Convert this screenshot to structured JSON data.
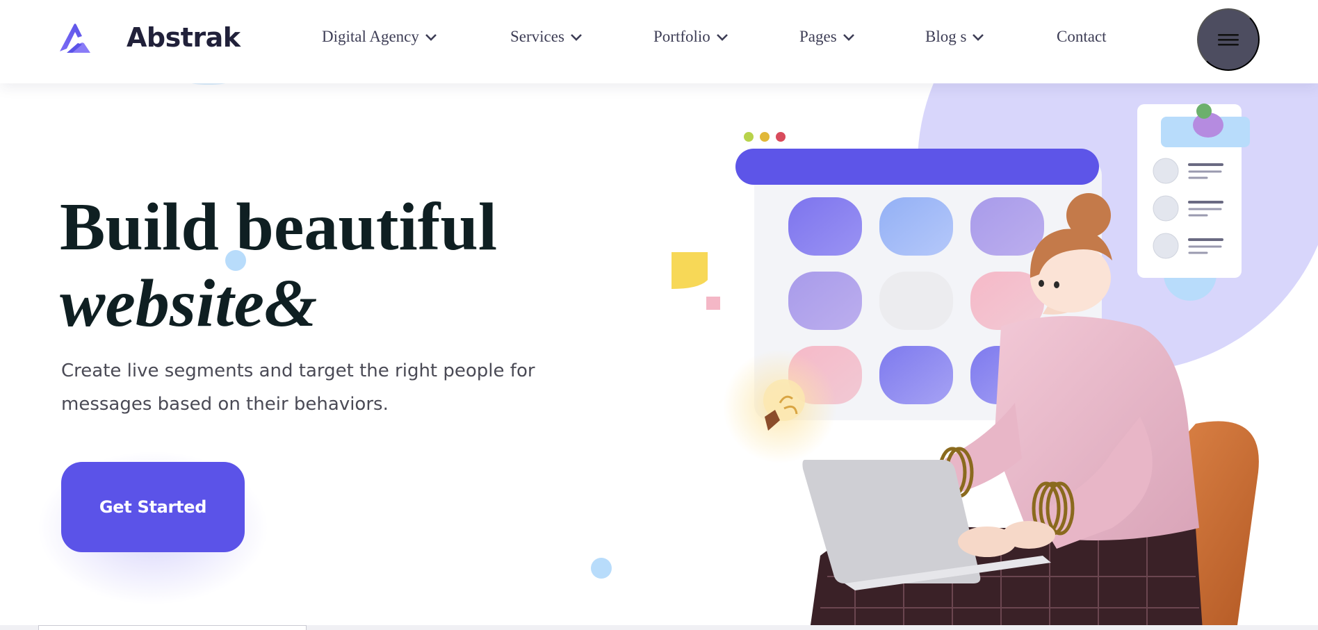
{
  "brand": {
    "name": "Abstrak",
    "logo_icon": "abstrak-logo-icon",
    "accent_color": "#5b53e8"
  },
  "nav": {
    "items": [
      {
        "label": "Digital Agency",
        "has_dropdown": true
      },
      {
        "label": "Services",
        "has_dropdown": true
      },
      {
        "label": "Portfolio",
        "has_dropdown": true
      },
      {
        "label": "Pages",
        "has_dropdown": true
      },
      {
        "label": "Blog s",
        "has_dropdown": true
      },
      {
        "label": "Contact",
        "has_dropdown": false
      }
    ],
    "menu_icon": "hamburger-menu-icon"
  },
  "hero": {
    "title_line1": "Build beautiful",
    "title_line2": "website&",
    "subtitle": "Create live segments and target the right people for messages based on their behaviors.",
    "cta_label": "Get Started"
  },
  "illustration": {
    "icon": "woman-working-on-laptop-illustration"
  }
}
